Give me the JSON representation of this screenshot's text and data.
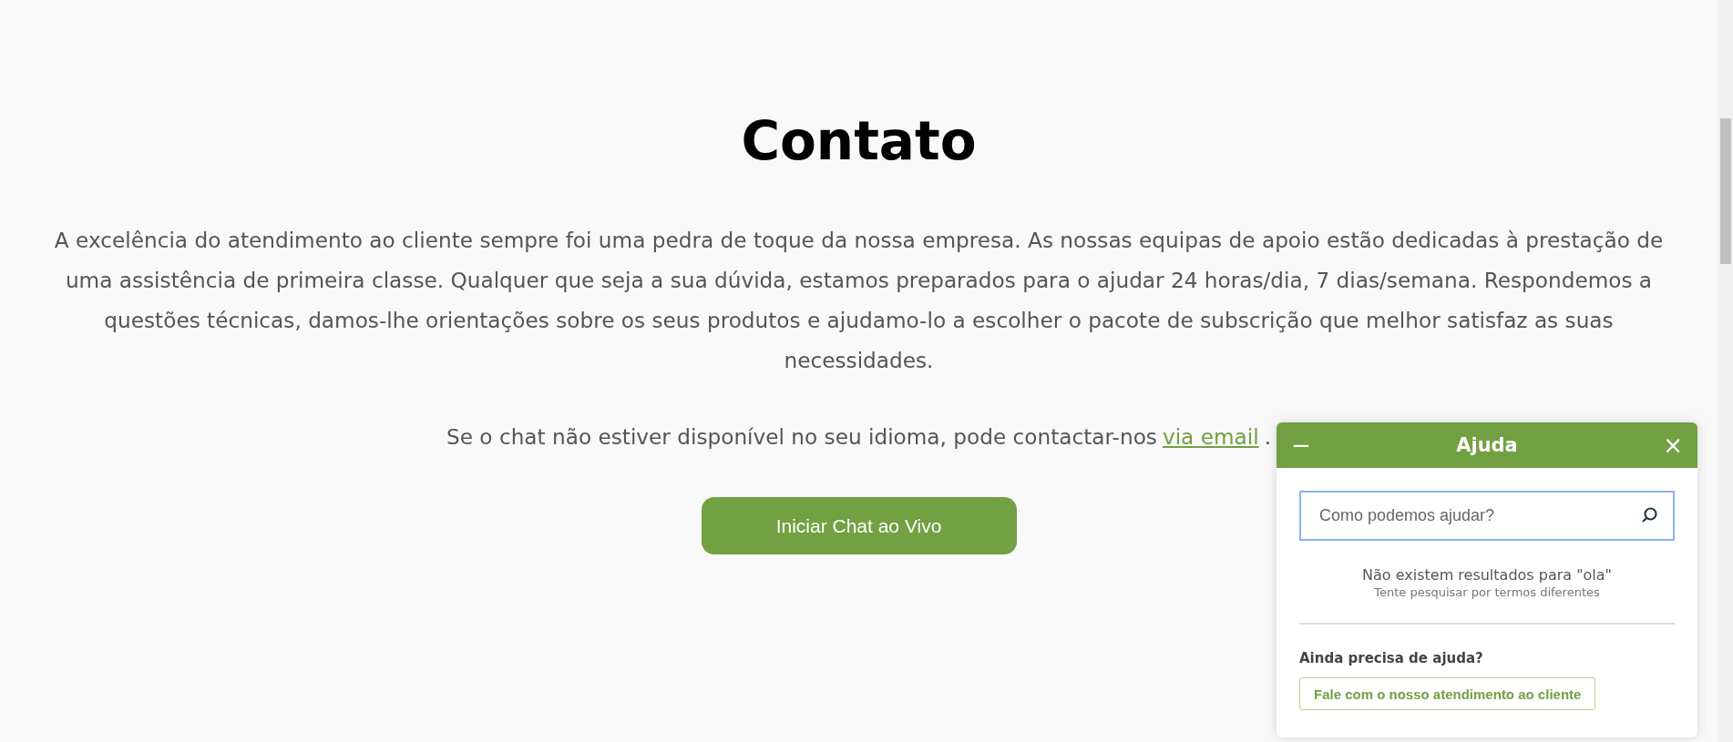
{
  "page": {
    "title": "Contato",
    "intro": "A excelência do atendimento ao cliente sempre foi uma pedra de toque da nossa empresa. As nossas equipas de apoio estão dedicadas à prestação de uma assistência de primeira classe. Qualquer que seja a sua dúvida, estamos preparados para o ajudar 24 horas/dia, 7 dias/semana. Respondemos a questões técnicas, damos-lhe orientações sobre os seus produtos e ajudamo-lo a escolher o pacote de subscrição que melhor satisfaz as suas necessidades.",
    "email_note": {
      "before": "Se o chat não estiver disponível no seu idioma, pode contactar-nos",
      "link": "via email ",
      "after": "."
    },
    "chat_button": "Iniciar Chat ao Vivo"
  },
  "help_widget": {
    "minimize": "−",
    "title": "Ajuda",
    "close": "×",
    "search": {
      "placeholder": "Como podemos ajudar?",
      "focused": true
    },
    "no_results": "Não existem resultados para \"ola\"",
    "hint": "Tente pesquisar por termos diferentes",
    "still_need_help": "Ainda precisa de ajuda?",
    "contact_button": "Fale com o nosso atendimento ao cliente"
  }
}
